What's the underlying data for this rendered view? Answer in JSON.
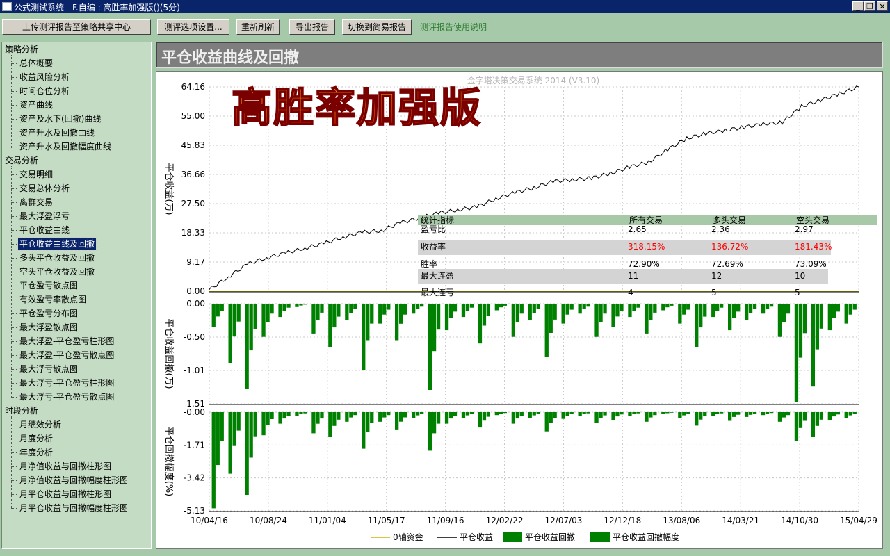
{
  "window": {
    "title": "公式测试系统 - F.自编 : 高胜率加强版()(5分)",
    "buttons": {
      "minimize": "_",
      "restore": "❐",
      "close": "✕"
    }
  },
  "toolbar": {
    "upload": "上传测评报告至策略共享中心",
    "settings": "测评选项设置...",
    "refresh": "重新刷新",
    "export": "导出报告",
    "switch": "切换到简易报告",
    "help": "测评报告使用说明"
  },
  "sidebar": {
    "groups": [
      {
        "label": "策略分析",
        "items": [
          "总体概要",
          "收益风险分析",
          "时间仓位分析",
          "资产曲线",
          "资产及水下(回撤)曲线",
          "资产升水及回撤曲线",
          "资产升水及回撤幅度曲线"
        ]
      },
      {
        "label": "交易分析",
        "items": [
          "交易明细",
          "交易总体分析",
          "离群交易",
          "最大浮盈浮亏",
          "平仓收益曲线",
          "平仓收益曲线及回撤",
          "多头平仓收益及回撤",
          "空头平仓收益及回撤",
          "平仓盈亏散点图",
          "有效盈亏率散点图",
          "平仓盈亏分布图",
          "最大浮盈散点图",
          "最大浮盈-平仓盈亏柱形图",
          "最大浮盈-平仓盈亏散点图",
          "最大浮亏散点图",
          "最大浮亏-平仓盈亏柱形图",
          "最大浮亏-平仓盈亏散点图"
        ]
      },
      {
        "label": "时段分析",
        "items": [
          "月绩效分析",
          "月度分析",
          "年度分析",
          "月净值收益与回撤柱形图",
          "月净值收益与回撤幅度柱形图",
          "月平仓收益与回撤柱形图",
          "月平仓收益与回撤幅度柱形图"
        ]
      }
    ],
    "selected": "平仓收益曲线及回撤"
  },
  "page_title": "平仓收益曲线及回撤",
  "watermark": "金字塔决策交易系统 2014 (V3.10)",
  "banner": "高胜率加强版",
  "stats": {
    "headers": [
      "统计指标",
      "所有交易",
      "多头交易",
      "空头交易"
    ],
    "rows": [
      {
        "label": "盈亏比",
        "values": [
          "2.65",
          "2.36",
          "2.97"
        ],
        "highlight": false
      },
      {
        "label": "收益率",
        "values": [
          "318.15%",
          "136.72%",
          "181.43%"
        ],
        "highlight": true
      },
      {
        "label": "胜率",
        "values": [
          "72.90%",
          "72.69%",
          "73.09%"
        ],
        "highlight": false
      },
      {
        "label": "最大连盈",
        "values": [
          "11",
          "12",
          "10"
        ],
        "highlight": true
      },
      {
        "label": "最大连亏",
        "values": [
          "4",
          "5",
          "5"
        ],
        "highlight": false
      }
    ]
  },
  "colors": {
    "equity": "#000000",
    "zero_axis": "#c8b400",
    "drawdown": "#008000",
    "grid": "#c8c8c8",
    "red_text": "#ff0000"
  },
  "chart_data": [
    {
      "type": "line",
      "ylabel": "平仓收益(万)",
      "yticks": [
        "64.16",
        "55.00",
        "45.83",
        "36.66",
        "27.50",
        "18.33",
        "9.17",
        "0.00"
      ],
      "ylim": [
        0,
        64.16
      ],
      "series": [
        {
          "name": "0轴资金",
          "values": [
            0,
            0
          ]
        },
        {
          "name": "平仓收益",
          "values": [
            0.5,
            4.5,
            8.5,
            10.5,
            12,
            13.5,
            15,
            17,
            18.5,
            19,
            21.5,
            23,
            24.5,
            25.5,
            26.5,
            29,
            31,
            32.5,
            34.5,
            35,
            35.5,
            37,
            39,
            40.5,
            44.5,
            48,
            49.5,
            50.5,
            51.5,
            52.5,
            53,
            58,
            60,
            62,
            64.16
          ]
        }
      ]
    },
    {
      "type": "area",
      "ylabel": "平仓收益回撤(万)",
      "yticks": [
        "-0.00",
        "-0.50",
        "-1.01",
        "-1.51"
      ],
      "ylim": [
        -1.51,
        0
      ],
      "series": [
        {
          "name": "平仓收益回撤",
          "values": [
            -0.35,
            -0.9,
            -1.28,
            -0.5,
            -0.2,
            -0.05,
            -0.45,
            -0.65,
            -0.25,
            -1.0,
            -0.3,
            -0.55,
            -0.15,
            -1.3,
            -0.4,
            -0.2,
            -0.6,
            -0.1,
            -0.5,
            -0.25,
            -0.8,
            -0.3,
            -0.15,
            -0.5,
            -0.35,
            -0.2,
            -0.45,
            -0.1,
            -0.3,
            -0.65,
            -0.2,
            -0.4,
            -0.25,
            -0.15,
            -0.5,
            -1.48,
            -1.25,
            -0.4,
            -0.3
          ]
        }
      ]
    },
    {
      "type": "area",
      "ylabel": "平仓回撤幅度(%)",
      "yticks": [
        "-0.00",
        "-1.71",
        "-3.42",
        "-5.13"
      ],
      "ylim": [
        -5.13,
        0
      ],
      "x": [
        "10/04/16",
        "10/08/24",
        "11/01/04",
        "11/05/17",
        "11/09/16",
        "12/02/22",
        "12/07/03",
        "12/12/18",
        "13/08/06",
        "14/03/21",
        "14/10/30",
        "15/04/29"
      ],
      "series": [
        {
          "name": "平仓收益回撤幅度",
          "values": [
            -5.0,
            -3.2,
            -4.3,
            -1.2,
            -0.6,
            -0.2,
            -1.1,
            -1.3,
            -0.5,
            -1.9,
            -0.5,
            -0.9,
            -0.3,
            -2.0,
            -0.6,
            -0.3,
            -0.8,
            -0.15,
            -0.6,
            -0.3,
            -1.0,
            -0.35,
            -0.2,
            -0.55,
            -0.4,
            -0.2,
            -0.5,
            -0.1,
            -0.3,
            -0.7,
            -0.2,
            -0.45,
            -0.25,
            -0.15,
            -0.5,
            -1.5,
            -1.3,
            -0.4,
            -0.3
          ]
        }
      ]
    }
  ]
}
